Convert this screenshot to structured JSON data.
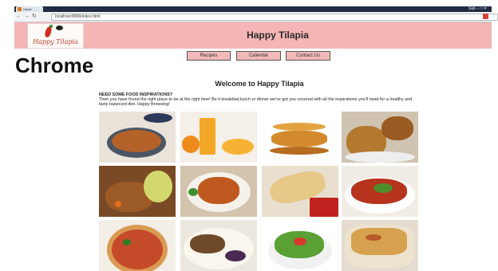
{
  "browser": {
    "tab_title": "Home",
    "address": "localhost:8000/index.html",
    "window_controls": "Sab − □ ✕"
  },
  "site": {
    "title": "Happy Tilapia",
    "logo_text": "Happy Tilapia"
  },
  "nav": [
    {
      "label": "Recipes"
    },
    {
      "label": "Calendar"
    },
    {
      "label": "Contact Us"
    }
  ],
  "overlay_label": "Chrome",
  "content": {
    "welcome": "Welcome to Happy Tilapia",
    "intro_heading": "NEED SOME FOOD INSPIRATIONS?",
    "intro_body": "Then you have found the right place to be at the right time! Be it breakfast,lunch or dinner we've got you covered with all the inspirations you'll need for a healthy and tasty balanced diet. Happy Browsing!"
  },
  "gallery_icons": [
    "bean-stew-bowl-image",
    "orange-juice-image",
    "pancake-stack-image",
    "fried-chicken-image",
    "chicken-stirfry-image",
    "roast-chicken-plate-image",
    "wrap-sandwich-image",
    "spicy-chicken-image",
    "pizza-image",
    "meatballs-mash-image",
    "fresh-salad-image",
    "baked-casserole-image"
  ]
}
